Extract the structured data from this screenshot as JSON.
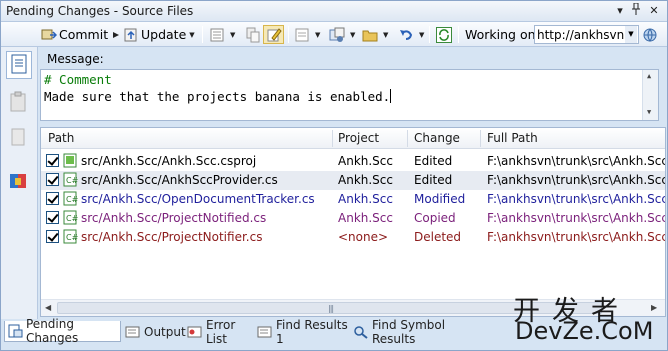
{
  "window": {
    "title": "Pending Changes - Source Files"
  },
  "toolbar": {
    "commit_label": "Commit",
    "update_label": "Update",
    "working_on_label": "Working on:",
    "working_on_value": "http://ankhsvn.c"
  },
  "message": {
    "label": "Message:",
    "comment_line": "# Comment",
    "text_line": "Made sure that the projects banana is enabled."
  },
  "columns": [
    "Path",
    "Project",
    "Change",
    "Full Path"
  ],
  "rows": [
    {
      "path": "src/Ankh.Scc/Ankh.Scc.csproj",
      "project": "Ankh.Scc",
      "change": "Edited",
      "full_path": "F:\\ankhsvn\\trunk\\src\\Ankh.Scc\\A",
      "color": "#000000"
    },
    {
      "path": "src/Ankh.Scc/AnkhSccProvider.cs",
      "project": "Ankh.Scc",
      "change": "Edited",
      "full_path": "F:\\ankhsvn\\trunk\\src\\Ankh.Scc\\A",
      "color": "#000000"
    },
    {
      "path": "src/Ankh.Scc/OpenDocumentTracker.cs",
      "project": "Ankh.Scc",
      "change": "Modified",
      "full_path": "F:\\ankhsvn\\trunk\\src\\Ankh.Scc\\C",
      "color": "#1f1f9c"
    },
    {
      "path": "src/Ankh.Scc/ProjectNotified.cs",
      "project": "Ankh.Scc",
      "change": "Copied",
      "full_path": "F:\\ankhsvn\\trunk\\src\\Ankh.Scc\\P",
      "color": "#7a1f7a"
    },
    {
      "path": "src/Ankh.Scc/ProjectNotifier.cs",
      "project": "<none>",
      "change": "Deleted",
      "full_path": "F:\\ankhsvn\\trunk\\src\\Ankh.Scc\\P",
      "color": "#8b1a1a"
    }
  ],
  "tabs": [
    "Pending Changes",
    "Output",
    "Error List",
    "Find Results 1",
    "Find Symbol Results"
  ],
  "watermark": {
    "cn": "开发者",
    "en": "DevZe.CoM"
  },
  "icons": {
    "commit": "commit-icon",
    "update": "update-icon",
    "refresh": "refresh-icon",
    "highlight": "highlight-icon",
    "folder": "folder-icon",
    "undo": "undo-icon"
  },
  "colors": {
    "accent": "#d6e4f3",
    "selection": "#e7ebf2",
    "comment": "#0a7d0a"
  }
}
